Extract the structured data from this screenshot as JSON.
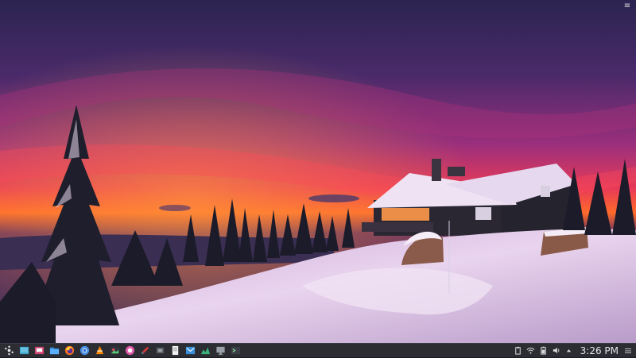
{
  "desktop": {
    "wallpaper_name": "snowy-cabin-sunset-wallpaper",
    "colors": {
      "sky_top": "#3a2a66",
      "sky_mid": "#8a2f7a",
      "sunset_red": "#f0344f",
      "sunset_orange": "#ff7a1f",
      "snow": "#e8d6f0",
      "tree": "#1a1c2c",
      "cabin": "#2a2a33"
    }
  },
  "panel": {
    "background": "#2b2d33",
    "launchers": [
      {
        "name": "application-menu-icon"
      },
      {
        "name": "desktop-pager-icon"
      },
      {
        "name": "system-settings-icon"
      },
      {
        "name": "file-manager-icon"
      },
      {
        "name": "firefox-icon"
      },
      {
        "name": "chromium-icon"
      },
      {
        "name": "vlc-icon"
      },
      {
        "name": "image-viewer-icon"
      },
      {
        "name": "media-player-icon"
      },
      {
        "name": "text-editor-icon"
      },
      {
        "name": "system-monitor-icon"
      },
      {
        "name": "document-viewer-icon"
      },
      {
        "name": "mail-client-icon"
      },
      {
        "name": "graph-icon"
      },
      {
        "name": "display-settings-icon"
      },
      {
        "name": "terminal-icon"
      }
    ],
    "tray": {
      "icons": [
        {
          "name": "clipboard-icon"
        },
        {
          "name": "network-wifi-icon"
        },
        {
          "name": "battery-icon"
        },
        {
          "name": "volume-icon"
        },
        {
          "name": "tray-expand-icon"
        }
      ],
      "clock": "3:26 PM"
    }
  }
}
